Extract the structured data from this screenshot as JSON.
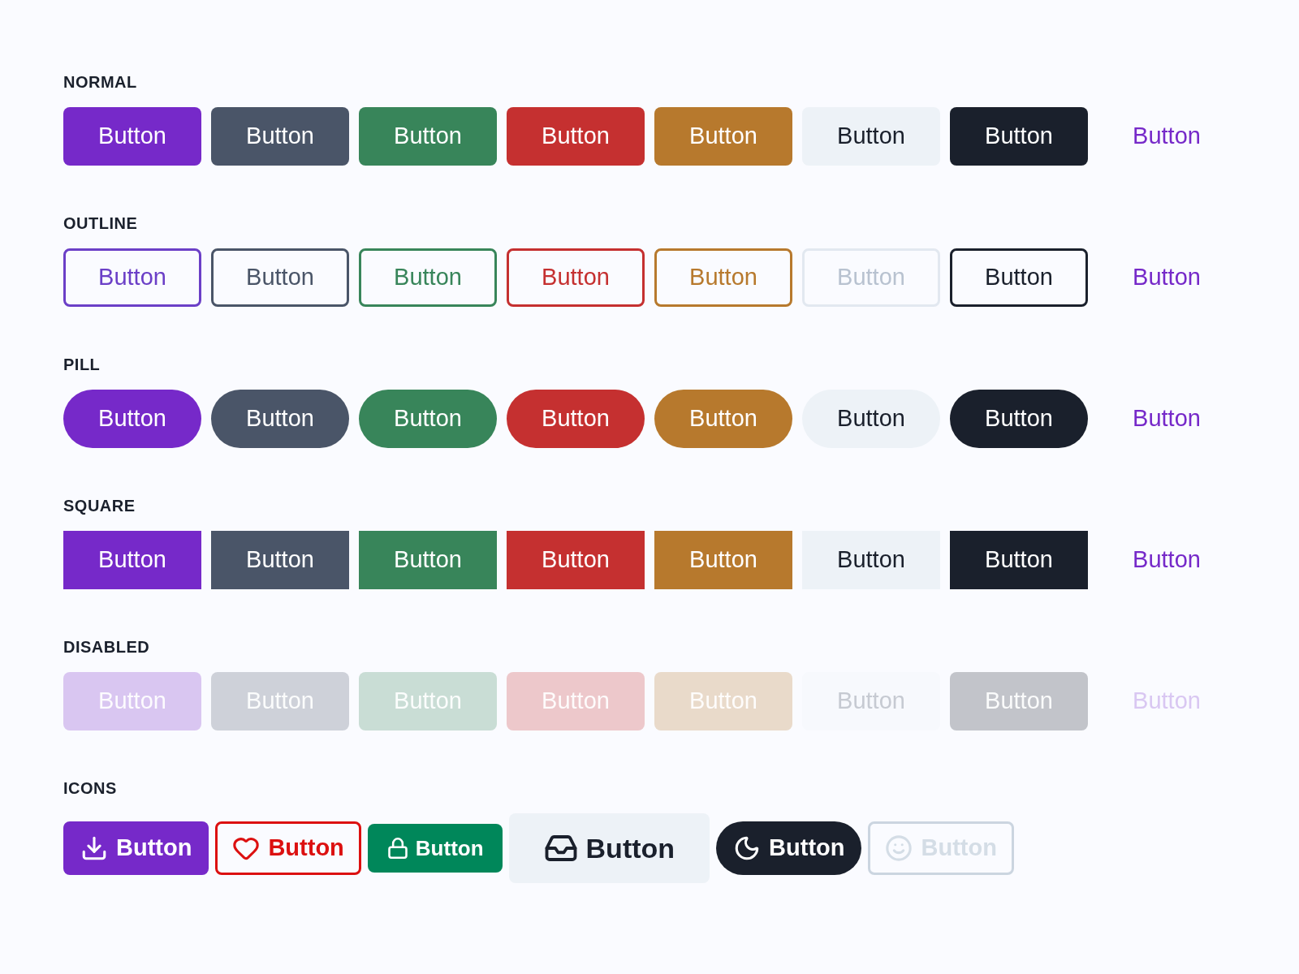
{
  "sections": [
    {
      "title": "NORMAL",
      "kind": "solid",
      "buttons": [
        {
          "label": "Button",
          "color": "#7629c9",
          "kind": "fill"
        },
        {
          "label": "Button",
          "color": "#4a5568",
          "kind": "fill"
        },
        {
          "label": "Button",
          "color": "#38855a",
          "kind": "fill"
        },
        {
          "label": "Button",
          "color": "#c53030",
          "kind": "fill"
        },
        {
          "label": "Button",
          "color": "#b7792d",
          "kind": "fill"
        },
        {
          "label": "Button",
          "color": "#edf2f7",
          "kind": "fill"
        },
        {
          "label": "Button",
          "color": "#1a202c",
          "kind": "fill"
        },
        {
          "label": "Button",
          "color": "#7629c9",
          "kind": "link"
        }
      ]
    },
    {
      "title": "OUTLINE",
      "kind": "outline",
      "buttons": [
        {
          "label": "Button",
          "color": "#6b3fc7",
          "kind": "fill"
        },
        {
          "label": "Button",
          "color": "#4a5568",
          "kind": "fill"
        },
        {
          "label": "Button",
          "color": "#38855a",
          "kind": "fill"
        },
        {
          "label": "Button",
          "color": "#c53030",
          "kind": "fill"
        },
        {
          "label": "Button",
          "color": "#b7792d",
          "kind": "fill"
        },
        {
          "label": "Button",
          "color": "#e2e8f0",
          "kind": "fill"
        },
        {
          "label": "Button",
          "color": "#1a202c",
          "kind": "fill"
        },
        {
          "label": "Button",
          "color": "#7629c9",
          "kind": "link"
        }
      ]
    },
    {
      "title": "PILL",
      "kind": "pill",
      "buttons": [
        {
          "label": "Button",
          "color": "#7629c9",
          "kind": "fill"
        },
        {
          "label": "Button",
          "color": "#4a5568",
          "kind": "fill"
        },
        {
          "label": "Button",
          "color": "#38855a",
          "kind": "fill"
        },
        {
          "label": "Button",
          "color": "#c53030",
          "kind": "fill"
        },
        {
          "label": "Button",
          "color": "#b7792d",
          "kind": "fill"
        },
        {
          "label": "Button",
          "color": "#edf2f7",
          "kind": "fill"
        },
        {
          "label": "Button",
          "color": "#1a202c",
          "kind": "fill"
        },
        {
          "label": "Button",
          "color": "#7629c9",
          "kind": "link"
        }
      ]
    },
    {
      "title": "SQUARE",
      "kind": "square",
      "buttons": [
        {
          "label": "Button",
          "color": "#7629c9",
          "kind": "fill"
        },
        {
          "label": "Button",
          "color": "#4a5568",
          "kind": "fill"
        },
        {
          "label": "Button",
          "color": "#38855a",
          "kind": "fill"
        },
        {
          "label": "Button",
          "color": "#c53030",
          "kind": "fill"
        },
        {
          "label": "Button",
          "color": "#b7792d",
          "kind": "fill"
        },
        {
          "label": "Button",
          "color": "#edf2f7",
          "kind": "fill"
        },
        {
          "label": "Button",
          "color": "#1a202c",
          "kind": "fill"
        },
        {
          "label": "Button",
          "color": "#7629c9",
          "kind": "link"
        }
      ]
    },
    {
      "title": "DISABLED",
      "kind": "solid",
      "buttons": [
        {
          "label": "Button",
          "color": "#d9c6f1",
          "kind": "fill",
          "disabled": true
        },
        {
          "label": "Button",
          "color": "#ced1d9",
          "kind": "fill",
          "disabled": true
        },
        {
          "label": "Button",
          "color": "#c9ddd5",
          "kind": "fill",
          "disabled": true
        },
        {
          "label": "Button",
          "color": "#edc8cb",
          "kind": "fill",
          "disabled": true
        },
        {
          "label": "Button",
          "color": "#e9daca",
          "kind": "fill",
          "disabled": true
        },
        {
          "label": "Button",
          "color": "#f7f9fd",
          "kind": "fill",
          "disabled": true
        },
        {
          "label": "Button",
          "color": "#c2c4ca",
          "kind": "fill",
          "disabled": true
        },
        {
          "label": "Button",
          "kind": "link",
          "disabled": true
        }
      ]
    },
    {
      "title": "ICONS",
      "kind": "icons",
      "buttons": [
        {
          "label": "Button",
          "color": "#7629c9",
          "kind": "fill",
          "disabled": false
        },
        {
          "label": "Button",
          "color": "#dc1010",
          "kind": "outline",
          "disabled": false
        },
        {
          "label": "Button",
          "color": "#00875a",
          "kind": "fill",
          "disabled": false
        },
        {
          "label": "Button",
          "color": "#edf2f7",
          "kind": "fill",
          "disabled": false
        },
        {
          "label": "Button",
          "color": "#1a202c",
          "kind": "pill",
          "disabled": false
        },
        {
          "label": "Button",
          "color": "#cbd5e0",
          "kind": "outline",
          "disabled": true
        }
      ]
    }
  ]
}
